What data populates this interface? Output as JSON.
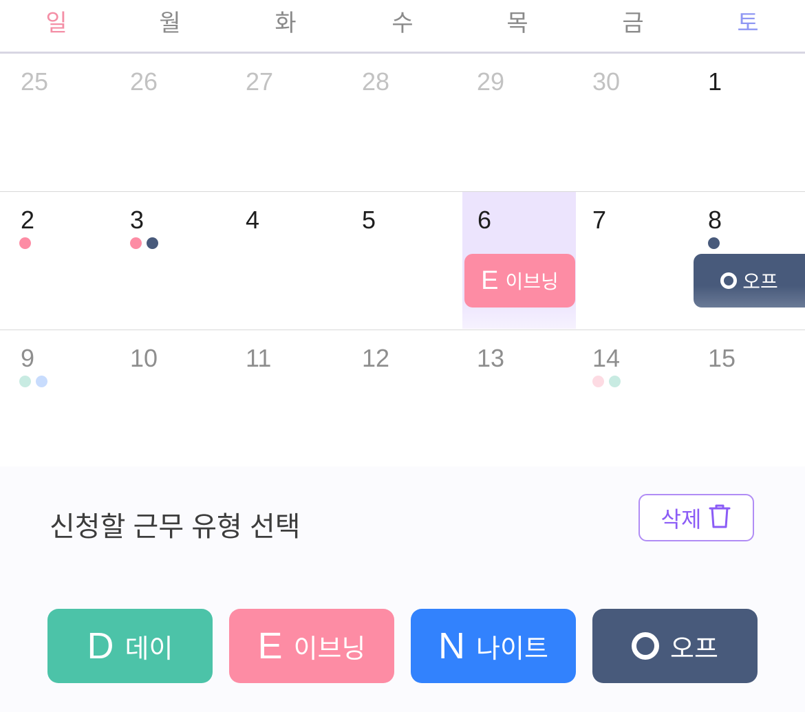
{
  "weekdays": [
    "일",
    "월",
    "화",
    "수",
    "목",
    "금",
    "토"
  ],
  "weeks": [
    [
      "25",
      "26",
      "27",
      "28",
      "29",
      "30",
      "1"
    ],
    [
      "2",
      "3",
      "4",
      "5",
      "6",
      "7",
      "8"
    ],
    [
      "9",
      "10",
      "11",
      "12",
      "13",
      "14",
      "15"
    ]
  ],
  "colors": {
    "day": "#4cc3a8",
    "evening": "#fd8ca4",
    "night": "#3282fd",
    "off": "#485a7b",
    "selected": "#ece4fd",
    "accent": "#8b5cf6"
  },
  "selected_day": "6",
  "chips": {
    "evening": {
      "letter": "E",
      "text": "이브닝"
    },
    "off": {
      "text": "오프"
    }
  },
  "panel": {
    "title": "신청할 근무 유형 선택",
    "delete_label": "삭제"
  },
  "shift_buttons": [
    {
      "letter": "D",
      "label": "데이"
    },
    {
      "letter": "E",
      "label": "이브닝"
    },
    {
      "letter": "N",
      "label": "나이트"
    },
    {
      "letter": "",
      "label": "오프"
    }
  ]
}
